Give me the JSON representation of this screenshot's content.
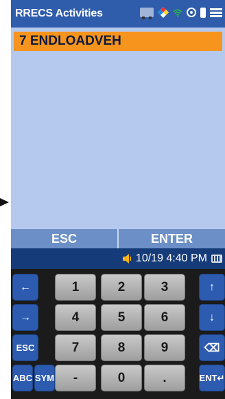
{
  "app": {
    "title": "RRECS Activities"
  },
  "status_icons": [
    "truck-icon",
    "hazard-diamond-icon",
    "wifi-icon",
    "location-icon",
    "battery-icon",
    "menu-icon"
  ],
  "activities": [
    {
      "label": "7 ENDLOADVEH",
      "selected": true
    }
  ],
  "softkeys": {
    "left": "ESC",
    "right": "ENTER"
  },
  "statusbar": {
    "datetime": "10/19 4:40 PM",
    "icons": [
      "speaker-icon",
      "keyboard-icon"
    ]
  },
  "keypad": {
    "left_arrow": "←",
    "right_arrow": "→",
    "esc": "ESC",
    "abc": "ABC",
    "sym": "SYM",
    "up_arrow": "↑",
    "down_arrow": "↓",
    "backspace": "⌫",
    "ent": "ENT↵",
    "keys": [
      "1",
      "2",
      "3",
      "4",
      "5",
      "6",
      "7",
      "8",
      "9",
      "-",
      "0",
      "."
    ]
  },
  "colors": {
    "titlebar": "#2f5cab",
    "list_background": "#b5c9ef",
    "selected_row": "#f7941d",
    "softkeys": "#6b8fc6",
    "statusbar": "#163b79",
    "side_keys": "#2c5bb0"
  }
}
